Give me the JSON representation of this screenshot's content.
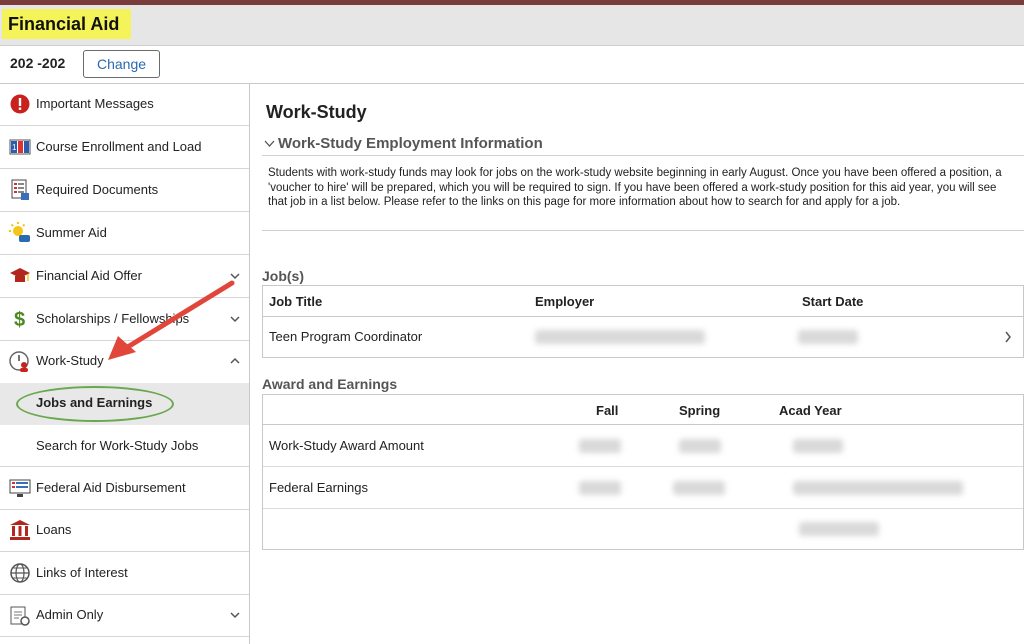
{
  "header": {
    "title": "Financial Aid"
  },
  "yearbar": {
    "aid_year": "202  -202",
    "change_label": "Change"
  },
  "sidebar": {
    "items": [
      {
        "label": "Important Messages",
        "icon": "alert-icon"
      },
      {
        "label": "Course Enrollment and Load",
        "icon": "enrollment-icon"
      },
      {
        "label": "Required Documents",
        "icon": "documents-icon"
      },
      {
        "label": "Summer Aid",
        "icon": "sun-icon"
      },
      {
        "label": "Financial Aid Offer",
        "icon": "graduation-cap-icon"
      },
      {
        "label": "Scholarships / Fellowships",
        "icon": "dollar-icon"
      },
      {
        "label": "Work-Study",
        "icon": "work-study-icon"
      },
      {
        "label": "Federal Aid Disbursement",
        "icon": "disbursement-icon"
      },
      {
        "label": "Loans",
        "icon": "bank-icon"
      },
      {
        "label": "Links of Interest",
        "icon": "globe-icon"
      },
      {
        "label": "Admin Only",
        "icon": "admin-icon"
      }
    ],
    "sub_items": [
      {
        "label": "Jobs and Earnings"
      },
      {
        "label": "Search for Work-Study Jobs"
      }
    ]
  },
  "main": {
    "title": "Work-Study",
    "section_title": "Work-Study Employment Information",
    "info_text": "Students with work-study funds may look for jobs on the work-study website beginning in early August.  Once you have been offered a position, a 'voucher to hire' will be prepared, which you will be required to sign.  If you have been offered a work-study position for this aid year, you will see that job in a list below.  Please refer to the links on this page for more information about how to search for and apply for a job.",
    "jobs": {
      "title": "Job(s)",
      "columns": [
        "Job Title",
        "Employer",
        "Start Date"
      ],
      "rows": [
        {
          "job_title": "Teen Program Coordinator"
        }
      ]
    },
    "awards": {
      "title": "Award and Earnings",
      "columns": [
        "Fall",
        "Spring",
        "Acad Year"
      ],
      "rows": [
        {
          "label": "Work-Study Award Amount"
        },
        {
          "label": "Federal Earnings"
        }
      ]
    }
  },
  "colors": {
    "highlight": "#f4f45a",
    "link": "#2a6ab1",
    "annotation_arrow": "#e0473a",
    "annotation_ellipse": "#6aa84f"
  }
}
